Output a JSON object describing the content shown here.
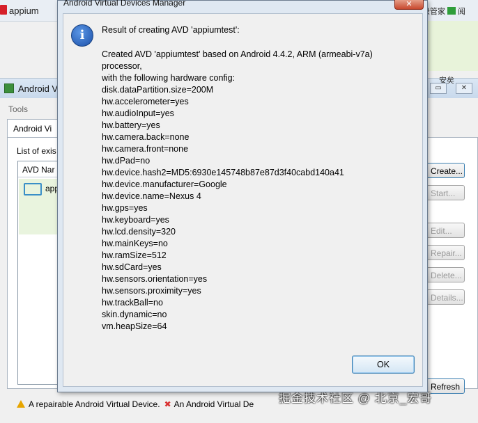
{
  "browser": {
    "tab_title": "appium",
    "right_text": "录管家",
    "right_text2": "阅"
  },
  "background_window": {
    "title": "Android V",
    "behind_text": "安矣",
    "minimize_label": "▭",
    "close_label": "✕",
    "tools_menu": "Tools",
    "tab_label": "Android Vi",
    "list_label": "List of exis",
    "table_header": "AVD Nar",
    "row_name": "appi",
    "buttons": {
      "create": "Create...",
      "start": "Start...",
      "edit": "Edit...",
      "repair": "Repair...",
      "delete": "Delete...",
      "details": "Details...",
      "refresh": "Refresh"
    },
    "legend_repairable": "A repairable Android Virtual Device.",
    "legend_invalid": "An Android Virtual De",
    "watermark": "掘金技术社区 @ 北京_宏哥"
  },
  "dialog": {
    "title": "Android Virtual Devices Manager",
    "close_label": "✕",
    "icon_glyph": "i",
    "message_title": "Result of creating AVD 'appiumtest':",
    "message_lines": [
      "Created AVD 'appiumtest' based on Android 4.4.2, ARM (armeabi-v7a)",
      "processor,",
      "with the following hardware config:",
      "disk.dataPartition.size=200M",
      "hw.accelerometer=yes",
      "hw.audioInput=yes",
      "hw.battery=yes",
      "hw.camera.back=none",
      "hw.camera.front=none",
      "hw.dPad=no",
      "hw.device.hash2=MD5:6930e145748b87e87d3f40cabd140a41",
      "hw.device.manufacturer=Google",
      "hw.device.name=Nexus 4",
      "hw.gps=yes",
      "hw.keyboard=yes",
      "hw.lcd.density=320",
      "hw.mainKeys=no",
      "hw.ramSize=512",
      "hw.sdCard=yes",
      "hw.sensors.orientation=yes",
      "hw.sensors.proximity=yes",
      "hw.trackBall=no",
      "skin.dynamic=no",
      "vm.heapSize=64"
    ],
    "ok_label": "OK"
  }
}
